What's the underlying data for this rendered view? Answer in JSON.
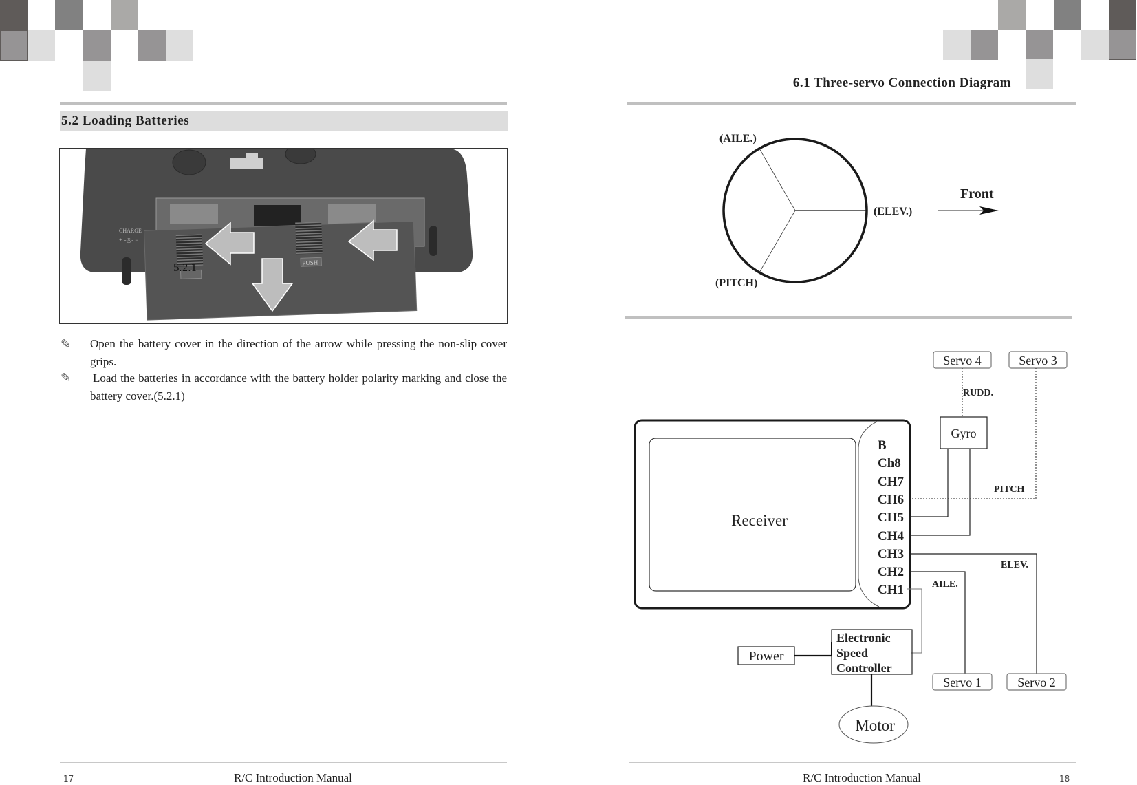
{
  "left_page": {
    "section_title": "5.2  Loading Batteries",
    "figure_label": "5.2.1",
    "photo_labels": {
      "charge": "CHARGE",
      "push": "PUSH"
    },
    "bullets": [
      {
        "icon": "pencil-icon",
        "text": "Open the battery cover in the direction of the arrow while pressing the non-slip cover grips."
      },
      {
        "icon": "pencil-icon",
        "text": "Load the batteries in accordance with the battery holder polarity marking and close the battery cover.(5.2.1)"
      }
    ],
    "footer": {
      "page_number": "17",
      "title": "R/C Introduction Manual"
    }
  },
  "right_page": {
    "section_title": "6.1  Three-servo Connection Diagram",
    "swashplate": {
      "labels": {
        "aile": "(AILE.)",
        "elev": "(ELEV.)",
        "pitch": "(PITCH)"
      },
      "front_label": "Front"
    },
    "wiring": {
      "receiver_label": "Receiver",
      "channels": [
        "B",
        "Ch8",
        "CH7",
        "CH6",
        "CH5",
        "CH4",
        "CH3",
        "CH2",
        "CH1"
      ],
      "servos": {
        "servo4": "Servo 4",
        "servo3": "Servo 3",
        "servo1": "Servo 1",
        "servo2": "Servo 2"
      },
      "gyro": "Gyro",
      "line_labels": {
        "rudd": "RUDD.",
        "pitch": "PITCH",
        "elev": "ELEV.",
        "aile": "AILE."
      },
      "esc_lines": [
        "Electronic",
        "Speed",
        "Controller"
      ],
      "power": "Power",
      "motor": "Motor"
    },
    "footer": {
      "page_number": "18",
      "title": "R/C Introduction Manual"
    }
  },
  "decor": {
    "square_colors": [
      "#5f5b59",
      "#818181",
      "#aaa9a7",
      "#969495",
      "#dedede"
    ]
  }
}
